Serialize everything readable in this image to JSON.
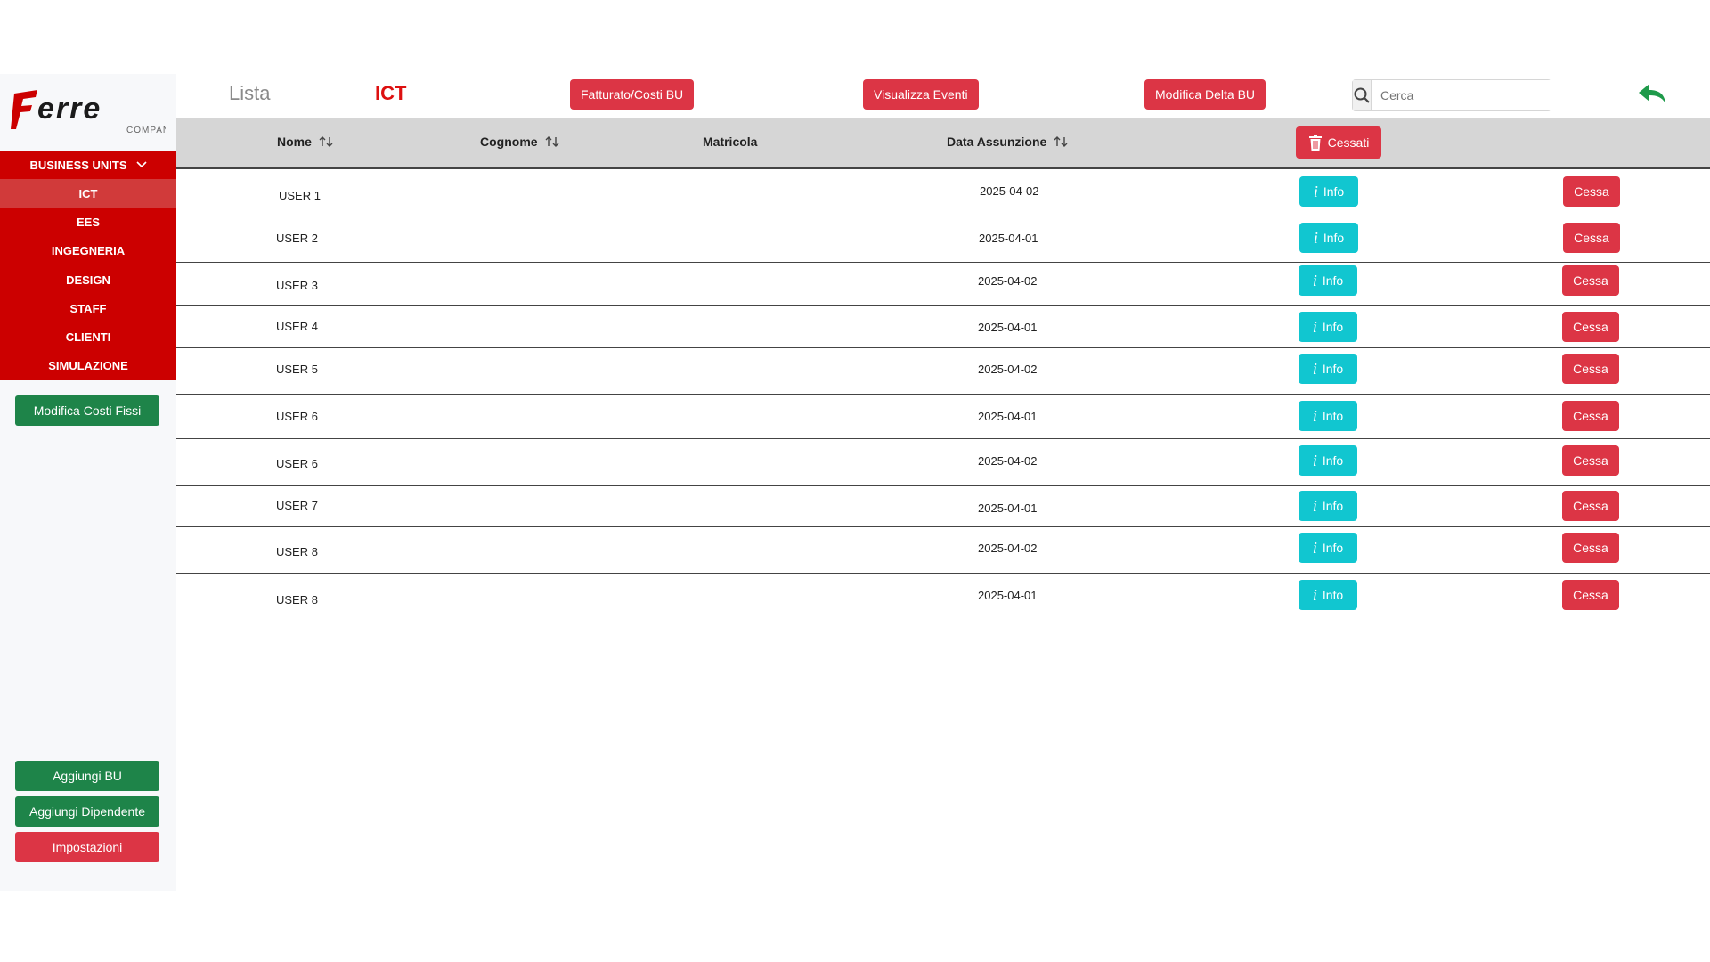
{
  "app": {
    "logo_text": "ferre",
    "logo_subtitle": "COMPANY",
    "brand_red": "#cc0000"
  },
  "sidebar": {
    "section_label": "BUSINESS UNITS",
    "items": [
      {
        "label": "ICT",
        "active": true
      },
      {
        "label": "EES",
        "active": false
      },
      {
        "label": "INGEGNERIA",
        "active": false
      },
      {
        "label": "DESIGN",
        "active": false
      },
      {
        "label": "STAFF",
        "active": false
      },
      {
        "label": "CLIENTI",
        "active": false
      },
      {
        "label": "SIMULAZIONE",
        "active": false
      }
    ],
    "modify_fixed_costs_label": "Modifica Costi Fissi",
    "add_bu_label": "Aggiungi BU",
    "add_employee_label": "Aggiungi Dipendente",
    "settings_label": "Impostazioni"
  },
  "header": {
    "list_label": "Lista",
    "bu_title": "ICT",
    "revenue_costs_label": "Fatturato/Costi BU",
    "view_events_label": "Visualizza Eventi",
    "modify_delta_label": "Modifica Delta BU",
    "search_placeholder": "Cerca",
    "search_value": ""
  },
  "table": {
    "columns": {
      "nome": "Nome",
      "cognome": "Cognome",
      "matricola": "Matricola",
      "data_assunzione": "Data Assunzione"
    },
    "cessati_label": "Cessati",
    "info_label": "Info",
    "cessa_label": "Cessa",
    "rows": [
      {
        "nome": "USER 1",
        "cognome": "",
        "matricola": "",
        "data": "2025-04-02"
      },
      {
        "nome": "USER 2",
        "cognome": "",
        "matricola": "",
        "data": "2025-04-01"
      },
      {
        "nome": "USER 3",
        "cognome": "",
        "matricola": "",
        "data": "2025-04-02"
      },
      {
        "nome": "USER 4",
        "cognome": "",
        "matricola": "",
        "data": "2025-04-01"
      },
      {
        "nome": "USER 5",
        "cognome": "",
        "matricola": "",
        "data": "2025-04-02"
      },
      {
        "nome": "USER 6",
        "cognome": "",
        "matricola": "",
        "data": "2025-04-01"
      },
      {
        "nome": "USER 6",
        "cognome": "",
        "matricola": "",
        "data": "2025-04-02"
      },
      {
        "nome": "USER 7",
        "cognome": "",
        "matricola": "",
        "data": "2025-04-01"
      },
      {
        "nome": "USER 8",
        "cognome": "",
        "matricola": "",
        "data": "2025-04-02"
      },
      {
        "nome": "USER 8",
        "cognome": "",
        "matricola": "",
        "data": "2025-04-01"
      }
    ]
  }
}
